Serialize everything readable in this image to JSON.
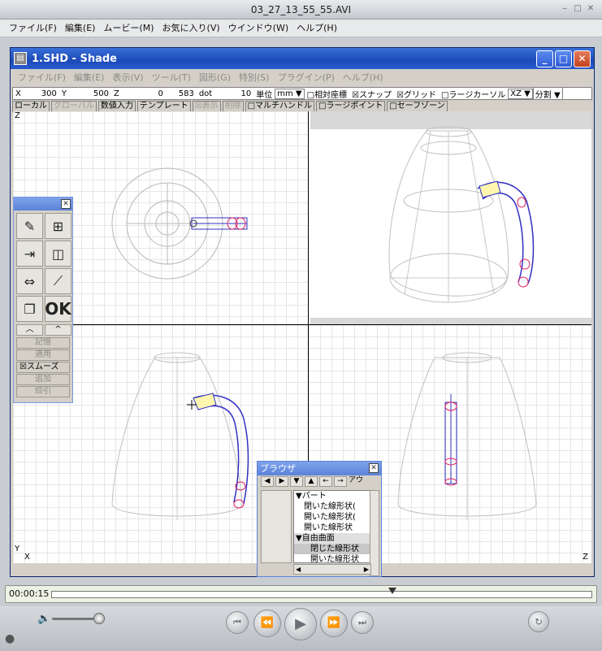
{
  "qt": {
    "title": "03_27_13_55_55.AVI",
    "menu": [
      "ファイル(F)",
      "編集(E)",
      "ムービー(M)",
      "お気に入り(V)",
      "ウインドウ(W)",
      "ヘルプ(H)"
    ],
    "time": "00:00:15",
    "playhead_fraction": 0.63
  },
  "shade": {
    "title": "1.SHD - Shade",
    "menu": [
      "ファイル(F)",
      "編集(E)",
      "表示(V)",
      "ツール(T)",
      "図形(G)",
      "特別(S)",
      "プラグイン(P)",
      "ヘルプ(H)"
    ],
    "coords": {
      "x_label": "X",
      "x_value": "300",
      "y_label": "Y",
      "y_value": "500",
      "z_label": "Z",
      "z_value": "0",
      "dot_value": "583",
      "dot_unit": "dot",
      "step": "10",
      "unit_label": "単位",
      "unit_value": "mm",
      "relative": "□相対座標",
      "snap": "☒スナップ",
      "grid": "☒グリッド",
      "large_cursor": "□ラージカーソル",
      "plane": "XZ",
      "split": "分割"
    },
    "options": {
      "local": "ローカル",
      "global": "グローバル",
      "numeric": "数値入力",
      "template": "テンプレート",
      "display": "☒表示",
      "delete": "削除",
      "multi_handle": "□マルチハンドル",
      "large_point": "□ラージポイント",
      "safe_zone": "□セーフゾーン"
    },
    "axes": {
      "z": "Z",
      "y": "Y",
      "x": "X",
      "z2": "Z"
    }
  },
  "palette": {
    "ok_label": "OK",
    "memory": "記憶",
    "apply": "適用",
    "smooth": "☒スムーズ",
    "add": "追加",
    "pull": "綜引"
  },
  "browser": {
    "title": "ブラウザ",
    "tools_tail": "アウ",
    "tree": [
      "▼パート",
      "閉いた線形状(",
      "開いた線形状(",
      "開いた線形状",
      "▼自由曲面",
      "閉じた線形状",
      "開いた線形状"
    ]
  }
}
